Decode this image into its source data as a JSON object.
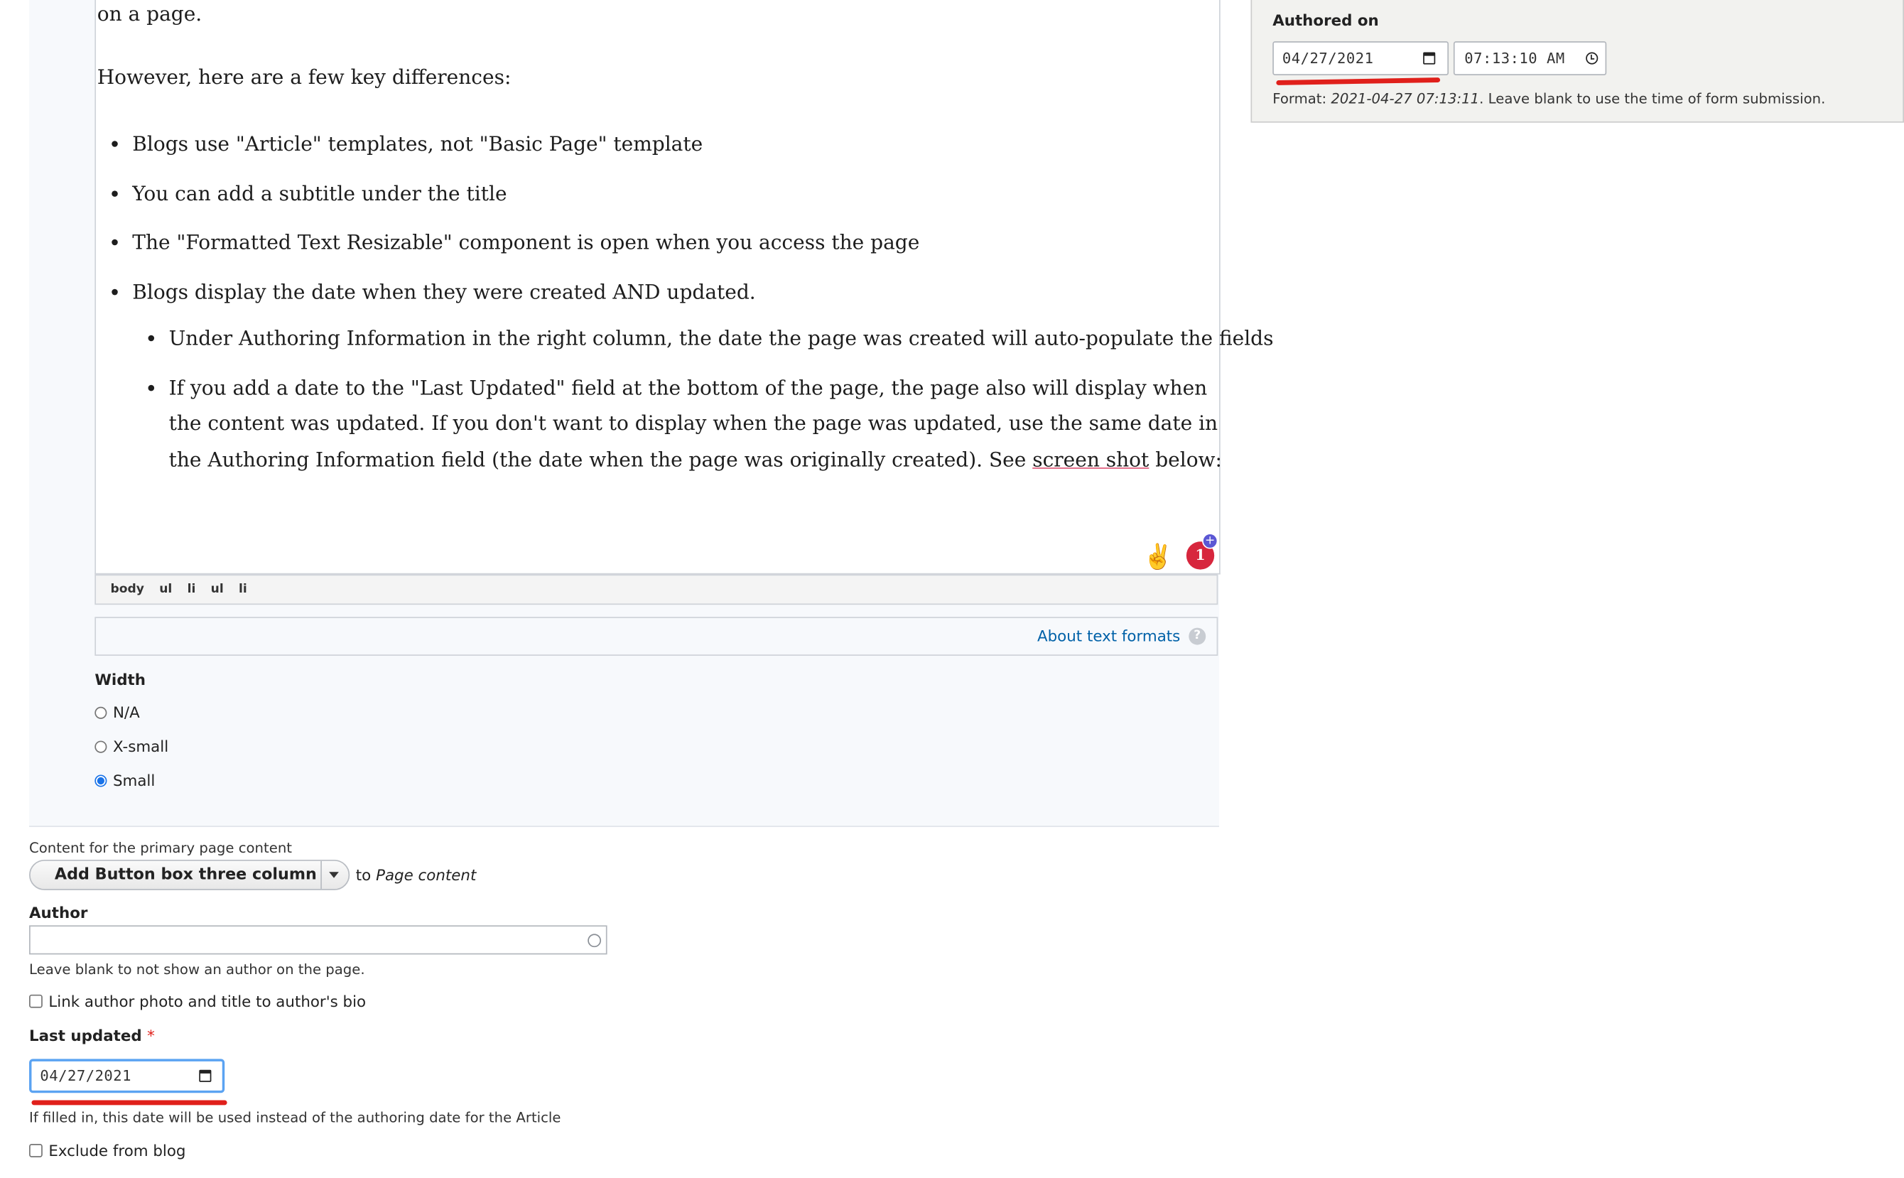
{
  "editor": {
    "line_top": "on a page.",
    "intro": "However, here are a few key differences:",
    "bullets": [
      "Blogs use \"Article\" templates, not \"Basic Page\" template",
      "You can add a subtitle under the title",
      "The \"Formatted Text Resizable\" component is open when you access the page",
      "Blogs display the date when they were created AND updated."
    ],
    "sub_bullets": {
      "first": "Under Authoring Information in the right column, the date the page was created will auto-populate the fields",
      "second_before": "If you add a date to the \"Last Updated\" field at the bottom of the page, the page also will display when the content was updated. If you don't want to display when the page was updated, use the same date in the Authoring Information field (the date when the page was originally created). See ",
      "second_link": "screen shot",
      "second_after": " below:"
    },
    "grammarly_badge_count": "1",
    "path": [
      "body",
      "ul",
      "li",
      "ul",
      "li"
    ],
    "about_text_formats": "About text formats",
    "help_glyph": "?"
  },
  "width_field": {
    "label": "Width",
    "options": [
      "N/A",
      "X-small",
      "Small"
    ],
    "selected": "Small"
  },
  "primary_content": {
    "caption": "Content for the primary page content",
    "button_label": "Add Button box three column",
    "to_text": "to",
    "target": "Page content"
  },
  "author": {
    "label": "Author",
    "value": "",
    "help": "Leave blank to not show an author on the page.",
    "link_checkbox_label": "Link author photo and title to author's bio"
  },
  "last_updated": {
    "label": "Last updated",
    "required_mark": "*",
    "value": "04/27/2021",
    "help": "If filled in, this date will be used instead of the authoring date for the Article"
  },
  "exclude_blog_label": "Exclude from blog",
  "authored_on": {
    "label": "Authored on",
    "date": "04/27/2021",
    "time": "07:13:10 AM",
    "format_prefix": "Format: ",
    "format_example": "2021-04-27 07:13:11",
    "format_suffix": ". Leave blank to use the time of form submission."
  },
  "colors": {
    "panel_bg": "#f7f9fc",
    "link": "#0061a8",
    "annotation_red": "#e0201b",
    "focus_blue": "#1a73e8"
  }
}
